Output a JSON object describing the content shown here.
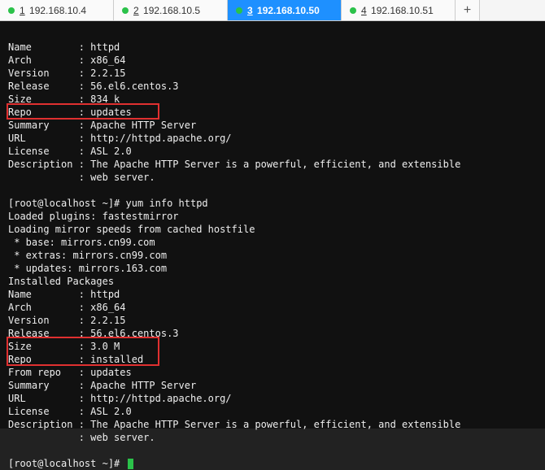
{
  "tabs": [
    {
      "num": "1",
      "label": "192.168.10.4",
      "active": false
    },
    {
      "num": "2",
      "label": "192.168.10.5",
      "active": false
    },
    {
      "num": "3",
      "label": "192.168.10.50",
      "active": true
    },
    {
      "num": "4",
      "label": "192.168.10.51",
      "active": false
    }
  ],
  "add_tab": "+",
  "prompt": {
    "user_host": "[root@localhost ~]",
    "hash": "#",
    "cmd": "yum info httpd"
  },
  "block1": {
    "l1": "Name        : httpd",
    "l2": "Arch        : x86_64",
    "l3": "Version     : 2.2.15",
    "l4": "Release     : 56.el6.centos.3",
    "l5": "Size        : 834 k",
    "l6": "Repo        : updates",
    "l7": "Summary     : Apache HTTP Server",
    "l8": "URL         : http://httpd.apache.org/",
    "l9": "License     : ASL 2.0",
    "l10": "Description : The Apache HTTP Server is a powerful, efficient, and extensible",
    "l11": "            : web server."
  },
  "mid": {
    "m1": "Loaded plugins: fastestmirror",
    "m2": "Loading mirror speeds from cached hostfile",
    "m3": " * base: mirrors.cn99.com",
    "m4": " * extras: mirrors.cn99.com",
    "m5": " * updates: mirrors.163.com",
    "m6": "Installed Packages"
  },
  "block2": {
    "l1": "Name        : httpd",
    "l2": "Arch        : x86_64",
    "l3": "Version     : 2.2.15",
    "l4": "Release     : 56.el6.centos.3",
    "l5": "Size        : 3.0 M",
    "l6": "Repo        : installed",
    "l6b": "From repo   : updates",
    "l7": "Summary     : Apache HTTP Server",
    "l8": "URL         : http://httpd.apache.org/",
    "l9": "License     : ASL 2.0",
    "l10": "Description : The Apache HTTP Server is a powerful, efficient, and extensible",
    "l11": "            : web server."
  }
}
